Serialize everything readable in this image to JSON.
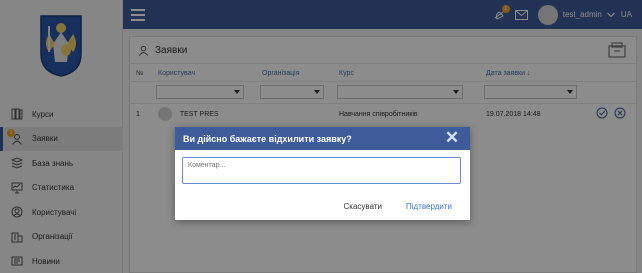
{
  "sidebar": {
    "items": [
      {
        "label": "Курси",
        "icon": "courses-icon"
      },
      {
        "label": "Заявки",
        "icon": "requests-icon",
        "badge": "1",
        "active": true
      },
      {
        "label": "База знань",
        "icon": "knowledge-base-icon"
      },
      {
        "label": "Статистика",
        "icon": "statistics-icon"
      },
      {
        "label": "Користувачі",
        "icon": "users-icon"
      },
      {
        "label": "Організації",
        "icon": "organizations-icon"
      },
      {
        "label": "Новини",
        "icon": "news-icon"
      }
    ]
  },
  "topbar": {
    "bell_badge": "1",
    "username": "test_admin",
    "language": "UA"
  },
  "page": {
    "title": "Заявки"
  },
  "table": {
    "columns": [
      "№",
      "Користувач",
      "Організація",
      "Курс",
      "Дата заявки ↓"
    ],
    "rows": [
      {
        "num": "1",
        "user": "TEST PRES",
        "org": "",
        "course": "Навчання співробітників",
        "date": "19.07.2018 14:48"
      }
    ]
  },
  "modal": {
    "title": "Ви дійсно бажаєте відхилити заявку?",
    "placeholder": "Коментар...",
    "cancel_label": "Скасувати",
    "confirm_label": "Підтвердити"
  },
  "colors": {
    "primary": "#3e5c99",
    "badge": "#f0a12b",
    "link": "#3e74c7"
  }
}
